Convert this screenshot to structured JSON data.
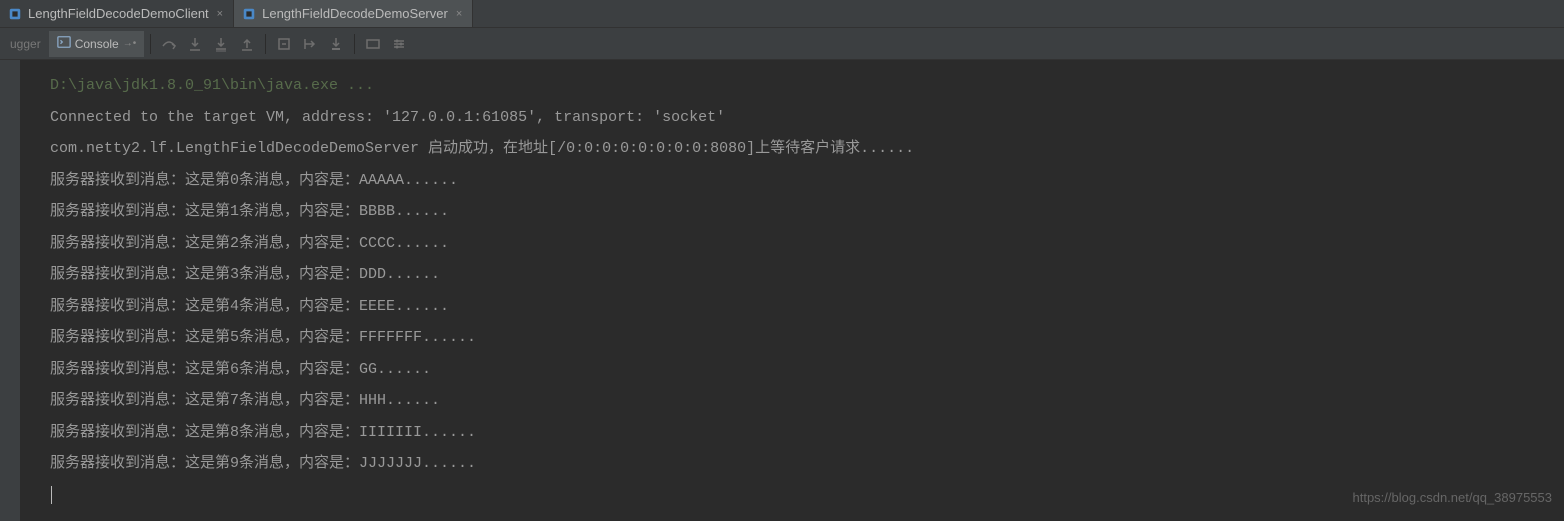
{
  "tabs": [
    {
      "label": "LengthFieldDecodeDemoClient",
      "active": false
    },
    {
      "label": "LengthFieldDecodeDemoServer",
      "active": true
    }
  ],
  "toolbar": {
    "debugger_label": "ugger",
    "console_label": "Console"
  },
  "console": {
    "path_line": "D:\\java\\jdk1.8.0_91\\bin\\java.exe ...",
    "connected_line": "Connected to the target VM, address: '127.0.0.1:61085', transport: 'socket'",
    "startup_line": "com.netty2.lf.LengthFieldDecodeDemoServer 启动成功，在地址[/0:0:0:0:0:0:0:0:8080]上等待客户请求......",
    "messages": [
      "服务器接收到消息：这是第0条消息，内容是：AAAAA......",
      "服务器接收到消息：这是第1条消息，内容是：BBBB......",
      "服务器接收到消息：这是第2条消息，内容是：CCCC......",
      "服务器接收到消息：这是第3条消息，内容是：DDD......",
      "服务器接收到消息：这是第4条消息，内容是：EEEE......",
      "服务器接收到消息：这是第5条消息，内容是：FFFFFFF......",
      "服务器接收到消息：这是第6条消息，内容是：GG......",
      "服务器接收到消息：这是第7条消息，内容是：HHH......",
      "服务器接收到消息：这是第8条消息，内容是：IIIIIII......",
      "服务器接收到消息：这是第9条消息，内容是：JJJJJJJ......"
    ]
  },
  "watermark": "https://blog.csdn.net/qq_38975553"
}
